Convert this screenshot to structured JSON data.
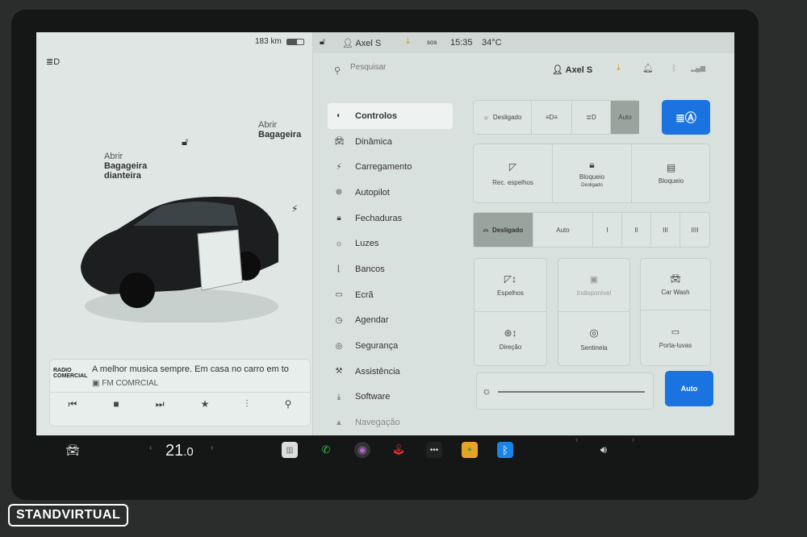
{
  "status": {
    "range": "183 km",
    "user": "Axel S",
    "sos": "sos",
    "time": "15:35",
    "temp": "34°C"
  },
  "left": {
    "frunk_label": "Abrir\nBagageira\ndianteira",
    "frunk_l1": "Abrir",
    "frunk_l2": "Bagageira",
    "frunk_l3": "dianteira",
    "trunk_l1": "Abrir",
    "trunk_l2": "Bagageira"
  },
  "media": {
    "station_logo_l1": "RADIO",
    "station_logo_l2": "COMERCIAL",
    "title": "A melhor musica sempre. Em casa no carro em to",
    "station": "FM COMRCIAL"
  },
  "search": {
    "placeholder": "Pesquisar",
    "user": "Axel S"
  },
  "menu": [
    {
      "label": "Controlos",
      "icon": "toggle-icon"
    },
    {
      "label": "Dinâmica",
      "icon": "car-icon"
    },
    {
      "label": "Carregamento",
      "icon": "bolt-icon"
    },
    {
      "label": "Autopilot",
      "icon": "steering-icon"
    },
    {
      "label": "Fechaduras",
      "icon": "lock-icon"
    },
    {
      "label": "Luzes",
      "icon": "sun-icon"
    },
    {
      "label": "Bancos",
      "icon": "seat-icon"
    },
    {
      "label": "Ecrã",
      "icon": "screen-icon"
    },
    {
      "label": "Agendar",
      "icon": "clock-icon"
    },
    {
      "label": "Segurança",
      "icon": "shield-icon"
    },
    {
      "label": "Assistência",
      "icon": "wrench-icon"
    },
    {
      "label": "Software",
      "icon": "download-icon"
    },
    {
      "label": "Navegação",
      "icon": "nav-icon"
    }
  ],
  "controls": {
    "lights": [
      "Desligado",
      "Auto"
    ],
    "mirrors_fold": "Rec. espelhos",
    "lock": "Bloqueio",
    "lock_sub": "Desligado",
    "lock2": "Bloqueio",
    "wipers": [
      "Desligado",
      "Auto",
      "I",
      "II",
      "III",
      "IIII"
    ],
    "tiles": [
      "Espelhos",
      "Direção",
      "Indisponível",
      "Sentinela",
      "Car Wash",
      "Porta-luvas"
    ],
    "brightness_auto": "Auto"
  },
  "dock": {
    "temp_int": "21",
    "temp_dec": ".0"
  },
  "watermark": "STANDVIRTUAL",
  "colors": {
    "accent": "#1a73e0",
    "screen": "#dce4e1"
  }
}
